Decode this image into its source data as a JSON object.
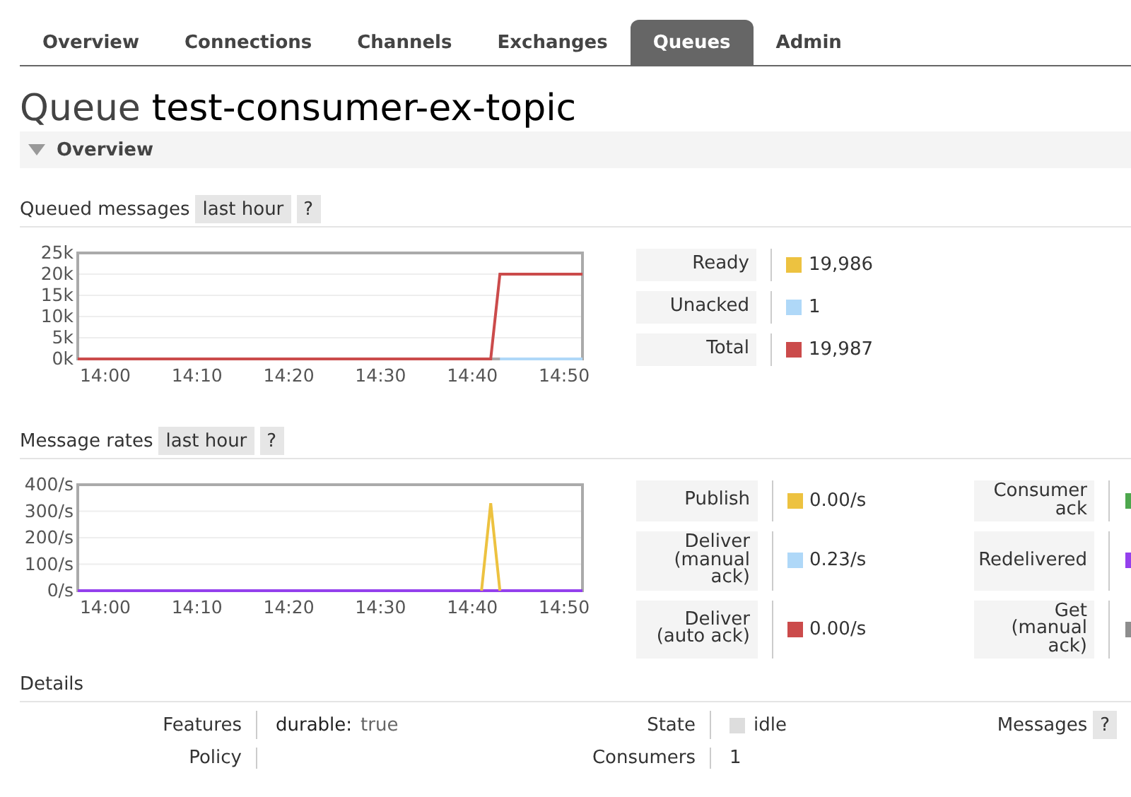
{
  "tabs": [
    {
      "label": "Overview",
      "selected": false
    },
    {
      "label": "Connections",
      "selected": false
    },
    {
      "label": "Channels",
      "selected": false
    },
    {
      "label": "Exchanges",
      "selected": false
    },
    {
      "label": "Queues",
      "selected": true
    },
    {
      "label": "Admin",
      "selected": false
    }
  ],
  "title": {
    "prefix": "Queue",
    "name": "test-consumer-ex-topic"
  },
  "overview": {
    "label": "Overview",
    "expanded": true
  },
  "queued": {
    "title": "Queued messages",
    "range": "last hour",
    "help": "?",
    "chart_data": {
      "type": "line",
      "grid": true,
      "ylim": [
        0,
        25000
      ],
      "categories": [
        null,
        null,
        null,
        "14:00",
        null,
        null,
        null,
        null,
        null,
        null,
        null,
        null,
        null,
        "14:10",
        null,
        null,
        null,
        null,
        null,
        null,
        null,
        null,
        null,
        "14:20",
        null,
        null,
        null,
        null,
        null,
        null,
        null,
        null,
        null,
        "14:30",
        null,
        null,
        null,
        null,
        null,
        null,
        null,
        null,
        null,
        "14:40",
        null,
        null,
        null,
        null,
        null,
        null,
        null,
        null,
        null,
        "14:50",
        null,
        null
      ],
      "series": [
        {
          "name": "Ready",
          "color": "#edc240",
          "values": [
            null,
            null,
            null,
            null,
            null,
            null,
            null,
            null,
            null,
            null,
            null,
            null,
            null,
            null,
            null,
            null,
            null,
            null,
            null,
            null,
            null,
            null,
            null,
            null,
            null,
            null,
            null,
            null,
            null,
            null,
            null,
            null,
            null,
            null,
            null,
            null,
            null,
            null,
            null,
            null,
            null,
            null,
            null,
            null,
            null,
            null,
            null,
            null,
            null,
            null,
            null,
            null,
            null,
            null,
            null,
            null
          ]
        },
        {
          "name": "Unacked",
          "color": "#afd8f8",
          "values": [
            null,
            null,
            null,
            null,
            null,
            null,
            null,
            null,
            null,
            null,
            null,
            null,
            null,
            null,
            null,
            null,
            null,
            null,
            null,
            null,
            null,
            null,
            null,
            null,
            null,
            null,
            null,
            null,
            null,
            null,
            null,
            null,
            null,
            null,
            null,
            null,
            null,
            null,
            null,
            null,
            null,
            null,
            null,
            null,
            null,
            null,
            0,
            0,
            0,
            0,
            0,
            0,
            0,
            0,
            0,
            0
          ]
        },
        {
          "name": "Total",
          "color": "#cb4b4b",
          "values": [
            0,
            0,
            0,
            0,
            0,
            0,
            0,
            0,
            0,
            0,
            0,
            0,
            0,
            0,
            0,
            0,
            0,
            0,
            0,
            0,
            0,
            0,
            0,
            0,
            0,
            0,
            0,
            0,
            0,
            0,
            0,
            0,
            0,
            0,
            0,
            0,
            0,
            0,
            0,
            0,
            0,
            0,
            0,
            0,
            0,
            0,
            20000,
            20000,
            20000,
            20000,
            20000,
            20000,
            20000,
            20000,
            20000,
            20000
          ]
        }
      ],
      "yticks": [
        {
          "value": 0,
          "label": "0k"
        },
        {
          "value": 5000,
          "label": "5k"
        },
        {
          "value": 10000,
          "label": "10k"
        },
        {
          "value": 15000,
          "label": "15k"
        },
        {
          "value": 20000,
          "label": "20k"
        },
        {
          "value": 25000,
          "label": "25k"
        }
      ]
    },
    "legend_values": [
      "19,986",
      "1",
      "19,987"
    ]
  },
  "rates": {
    "title": "Message rates",
    "range": "last hour",
    "help": "?",
    "chart_data": {
      "type": "line",
      "grid": true,
      "ylim": [
        0,
        400
      ],
      "categories": [
        null,
        null,
        null,
        "14:00",
        null,
        null,
        null,
        null,
        null,
        null,
        null,
        null,
        null,
        "14:10",
        null,
        null,
        null,
        null,
        null,
        null,
        null,
        null,
        null,
        "14:20",
        null,
        null,
        null,
        null,
        null,
        null,
        null,
        null,
        null,
        "14:30",
        null,
        null,
        null,
        null,
        null,
        null,
        null,
        null,
        null,
        "14:40",
        null,
        null,
        null,
        null,
        null,
        null,
        null,
        null,
        null,
        "14:50",
        null,
        null
      ],
      "series": [
        {
          "name": "Publish",
          "color": "#edc240",
          "values": [
            null,
            null,
            null,
            null,
            null,
            null,
            null,
            null,
            null,
            null,
            null,
            null,
            null,
            null,
            null,
            null,
            null,
            null,
            null,
            null,
            null,
            null,
            null,
            null,
            null,
            null,
            null,
            null,
            null,
            null,
            null,
            null,
            null,
            null,
            null,
            null,
            null,
            null,
            null,
            null,
            null,
            null,
            null,
            null,
            0,
            330,
            0,
            null,
            null,
            null,
            null,
            null,
            null,
            null,
            null,
            null
          ]
        },
        {
          "name": "Deliver (manual ack)",
          "color": "#afd8f8",
          "values": [
            null,
            null,
            null,
            null,
            null,
            null,
            null,
            null,
            null,
            null,
            null,
            null,
            null,
            null,
            null,
            null,
            null,
            null,
            null,
            null,
            null,
            null,
            null,
            null,
            null,
            null,
            null,
            null,
            null,
            null,
            null,
            null,
            null,
            null,
            null,
            null,
            null,
            null,
            null,
            null,
            null,
            null,
            null,
            null,
            null,
            null,
            null,
            null,
            null,
            null,
            null,
            null,
            null,
            null,
            null,
            null
          ]
        },
        {
          "name": "Deliver (auto ack)",
          "color": "#cb4b4b",
          "values": [
            null,
            null,
            null,
            null,
            null,
            null,
            null,
            null,
            null,
            null,
            null,
            null,
            null,
            null,
            null,
            null,
            null,
            null,
            null,
            null,
            null,
            null,
            null,
            null,
            null,
            null,
            null,
            null,
            null,
            null,
            null,
            null,
            null,
            null,
            null,
            null,
            null,
            null,
            null,
            null,
            null,
            null,
            null,
            null,
            null,
            null,
            null,
            null,
            null,
            null,
            null,
            null,
            null,
            null,
            null,
            null
          ]
        },
        {
          "name": "Consumer ack",
          "color": "#4da74d",
          "values": [
            null,
            null,
            null,
            null,
            null,
            null,
            null,
            null,
            null,
            null,
            null,
            null,
            null,
            null,
            null,
            null,
            null,
            null,
            null,
            null,
            null,
            null,
            null,
            null,
            null,
            null,
            null,
            null,
            null,
            null,
            null,
            null,
            null,
            null,
            null,
            null,
            null,
            null,
            null,
            null,
            null,
            null,
            null,
            null,
            null,
            null,
            null,
            null,
            null,
            null,
            null,
            null,
            null,
            null,
            null,
            null
          ]
        },
        {
          "name": "Redelivered",
          "color": "#9440ed",
          "values": [
            0,
            0,
            0,
            0,
            0,
            0,
            0,
            0,
            0,
            0,
            0,
            0,
            0,
            0,
            0,
            0,
            0,
            0,
            0,
            0,
            0,
            0,
            0,
            0,
            0,
            0,
            0,
            0,
            0,
            0,
            0,
            0,
            0,
            0,
            0,
            0,
            0,
            0,
            0,
            0,
            0,
            0,
            0,
            0,
            0,
            0,
            0,
            0,
            0,
            0,
            0,
            0,
            0,
            0,
            0,
            0
          ]
        },
        {
          "name": "Get (manual ack)",
          "color": "#8d8d8d",
          "values": [
            null,
            null,
            null,
            null,
            null,
            null,
            null,
            null,
            null,
            null,
            null,
            null,
            null,
            null,
            null,
            null,
            null,
            null,
            null,
            null,
            null,
            null,
            null,
            null,
            null,
            null,
            null,
            null,
            null,
            null,
            null,
            null,
            null,
            null,
            null,
            null,
            null,
            null,
            null,
            null,
            null,
            null,
            null,
            null,
            null,
            null,
            null,
            null,
            null,
            null,
            null,
            null,
            null,
            null,
            null,
            null
          ]
        }
      ],
      "yticks": [
        {
          "value": 0,
          "label": "0/s"
        },
        {
          "value": 100,
          "label": "100/s"
        },
        {
          "value": 200,
          "label": "200/s"
        },
        {
          "value": 300,
          "label": "300/s"
        },
        {
          "value": 400,
          "label": "400/s"
        }
      ]
    },
    "legend_values": [
      "0.00/s",
      "0.23/s",
      "0.00/s"
    ]
  },
  "details": {
    "title": "Details",
    "left": [
      {
        "label": "Features",
        "key": "durable:",
        "value": "true"
      },
      {
        "label": "Policy"
      }
    ],
    "middle": [
      {
        "label": "State",
        "value": "idle",
        "color": "#dddddd"
      },
      {
        "label": "Consumers",
        "value": "1"
      }
    ],
    "right": [
      {
        "label": "Messages",
        "help": "?"
      }
    ]
  }
}
